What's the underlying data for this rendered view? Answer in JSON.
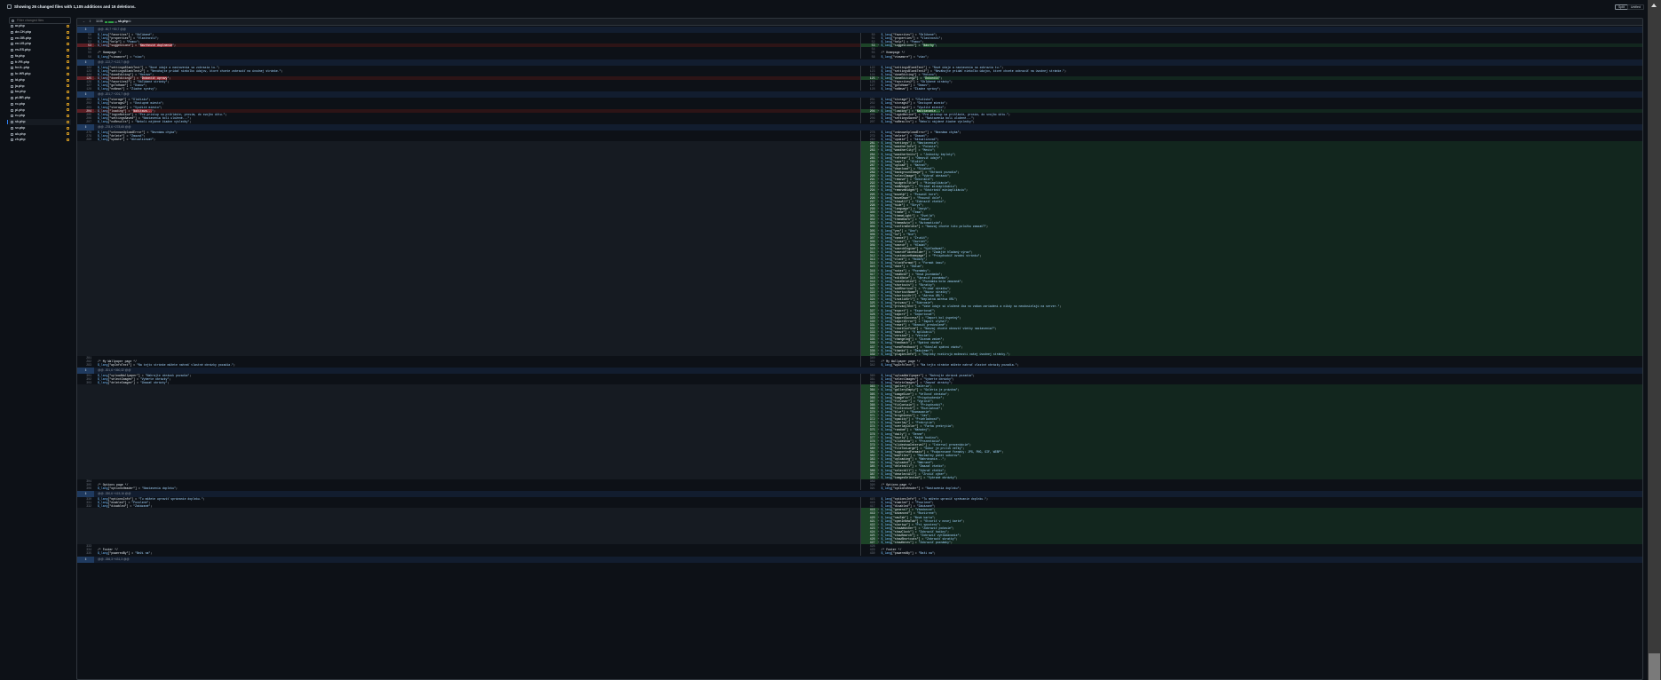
{
  "header": {
    "summary": "Showing 26 changed files with 1,105 additions and 16 deletions.",
    "split_label": "Split",
    "unified_label": "Unified"
  },
  "sidebar": {
    "filter_placeholder": "Filter changed files",
    "selected_index": 16,
    "files": [
      "ar.php",
      "de-CH.php",
      "en-GB.php",
      "en-US.php",
      "es-ES.php",
      "fa.php",
      "fr-FR.php",
      "he-IL.php",
      "hr-HR.php",
      "id.php",
      "ja.php",
      "ko.php",
      "pt-BR.php",
      "ro.php",
      "pl.php",
      "ru.php",
      "sk.php",
      "sv.php",
      "uk.php",
      "zh.php"
    ]
  },
  "file": {
    "changes": "1105",
    "name": "sk.php"
  },
  "hunks": [
    {
      "header": "@@ -50,7 +50,7 @@",
      "rows": [
        [
          "c",
          50,
          50,
          "$_lang[\"favorites\"] = \"Obľúbené\";"
        ],
        [
          "c",
          51,
          51,
          "$_lang[\"properties\"] = \"Vlastnosti\";"
        ],
        [
          "c",
          52,
          52,
          "$_lang[\"help\"] = \"Pomoc\";"
        ],
        [
          "m",
          53,
          53,
          "$_lang[\"suggestions\"] = \"Navrhnuté doplnenie\";",
          "$_lang[\"suggestions\"] = \"Návrhy\";",
          "Navrhnuté doplnenie",
          "Návrhy"
        ],
        [
          "c",
          54,
          54,
          ""
        ],
        [
          "c",
          55,
          55,
          "/* Homepage */"
        ],
        [
          "c",
          56,
          56,
          "$_lang[\"viewmore\"] = \"viac\";"
        ]
      ]
    },
    {
      "header": "@@ -122,7 +122,7 @@",
      "rows": [
        [
          "c",
          122,
          122,
          "$_lang[\"settingsBlankText\"] = \"Nové údaje a nastavenia sa zobrazia tu.\";"
        ],
        [
          "c",
          123,
          123,
          "$_lang[\"settingsBlankText2\"] = \"Neváhajte pridať niekoľko údajov, ktoré chcete zobraziť na úvodnej stránke.\";"
        ],
        [
          "c",
          124,
          124,
          "$_lang[\"doneEditing\"] = \"Hotovo\";"
        ],
        [
          "m",
          125,
          125,
          "$_lang[\"doneEditing2\"] = \"Dokončiť úpravy\";",
          "$_lang[\"doneEditing2\"] = \"Dokončiť\";",
          "Dokončiť úpravy",
          "Dokončiť"
        ],
        [
          "c",
          126,
          126,
          "$_lang[\"favorites2\"] = \"Obľúbené stránky\";"
        ],
        [
          "c",
          127,
          127,
          "$_lang[\"goToHome\"] = \"Domov\";"
        ],
        [
          "c",
          128,
          128,
          "$_lang[\"noNews\"] = \"Žiadne správy\";"
        ]
      ]
    },
    {
      "header": "@@ -201,7 +201,7 @@",
      "rows": [
        [
          "c",
          201,
          201,
          "$_lang[\"storage\"] = \"Úložisko\";"
        ],
        [
          "c",
          202,
          202,
          "$_lang[\"storage2\"] = \"Dostupné miesto\";"
        ],
        [
          "c",
          203,
          203,
          "$_lang[\"storage3\"] = \"Využité miesto\";"
        ],
        [
          "m",
          204,
          204,
          "$_lang[\"loading\"] = \"Načítava...\";",
          "$_lang[\"loading\"] = \"Načítavanie...\";",
          "Načítava...",
          "Načítavanie..."
        ],
        [
          "c",
          205,
          205,
          "$_lang[\"loginNotice\"] = \"Pre prístup sa prihláste, prosím, do svojho účtu.\";"
        ],
        [
          "c",
          206,
          206,
          "$_lang[\"settingsSaved\"] = \"Nastavenia boli uložené...\";"
        ],
        [
          "c",
          207,
          207,
          "$_lang[\"noResults\"] = \"Neboli nájdené žiadne výsledky\";"
        ]
      ]
    },
    {
      "header": "@@ -278,6 +278,65 @@",
      "rows": [
        [
          "c",
          278,
          278,
          "$_lang[\"unknownUploadError\"] = \"Neznáma chyba\";"
        ],
        [
          "c",
          279,
          279,
          "$_lang[\"delete\"] = \"Zmazať\";"
        ],
        [
          "c",
          280,
          280,
          "$_lang[\"update\"] = \"Aktualizovať\";"
        ],
        [
          "A",
          281,
          [
            "$_lang[\"settings\"] = \"Nastavenia\";",
            "$_lang[\"weatherInfo\"] = \"Počasie\";",
            "$_lang[\"weatherCity\"] = \"Mesto\";",
            "$_lang[\"weatherUnits\"] = \"Jednotky teploty\";",
            "$_lang[\"refresh\"] = \"Obnoviť údaje\";",
            "$_lang[\"save\"] = \"Uložiť\";",
            "$_lang[\"upload\"] = \"Nahrať\";",
            "$_lang[\"download\"] = \"Stiahnuť\";",
            "$_lang[\"backgroundImage\"] = \"Obrázok pozadia\";",
            "$_lang[\"selectImage\"] = \"Vybrať obrázok\";",
            "$_lang[\"remove\"] = \"Odstrániť\";",
            "$_lang[\"widgetsTitle\"] = \"Miniaplikácie\";",
            "$_lang[\"addWidget\"] = \"Pridať miniaplikáciu\";",
            "$_lang[\"removeWidget\"] = \"Odstrániť miniaplikáciu\";",
            "$_lang[\"moveUp\"] = \"Posunúť hore\";",
            "$_lang[\"moveDown\"] = \"Posunúť dole\";",
            "$_lang[\"showAll\"] = \"Zobraziť všetko\";",
            "$_lang[\"hide\"] = \"Skryť\";",
            "$_lang[\"language\"] = \"Jazyk\";",
            "$_lang[\"theme\"] = \"Téma\";",
            "$_lang[\"themeLight\"] = \"Svetlá\";",
            "$_lang[\"themeDark\"] = \"Tmavá\";",
            "$_lang[\"themeAuto\"] = \"Automatická\";",
            "$_lang[\"confirmDelete\"] = \"Naozaj chcete túto položku zmazať?\";",
            "$_lang[\"yes\"] = \"Áno\";",
            "$_lang[\"no\"] = \"Nie\";",
            "$_lang[\"cancel\"] = \"Zrušiť\";",
            "$_lang[\"close\"] = \"Zavrieť\";",
            "$_lang[\"search\"] = \"Hľadať\";",
            "$_lang[\"searchEngine\"] = \"Vyhľadávač\";",
            "$_lang[\"searchPlaceholder\"] = \"Zadajte hľadaný výraz\";",
            "$_lang[\"customizeHomepage\"] = \"Prispôsobiť úvodnú stránku\";",
            "$_lang[\"clock\"] = \"Hodiny\";",
            "$_lang[\"clockFormat\"] = \"Formát času\";",
            "$_lang[\"date\"] = \"Dátum\";",
            "$_lang[\"notes\"] = \"Poznámky\";",
            "$_lang[\"newNote\"] = \"Nová poznámka\";",
            "$_lang[\"editNote\"] = \"Upraviť poznámku\";",
            "$_lang[\"noteDeleted\"] = \"Poznámka bola zmazaná\";",
            "$_lang[\"shortcuts\"] = \"Skratky\";",
            "$_lang[\"addShortcut\"] = \"Pridať skratku\";",
            "$_lang[\"shortcutName\"] = \"Názov skratky\";",
            "$_lang[\"shortcutUrl\"] = \"Adresa URL\";",
            "$_lang[\"invalidUrl\"] = \"Neplatná adresa URL\";",
            "$_lang[\"privacy\"] = \"Súkromie\";",
            "$_lang[\"privacyText\"] = \"Vaše údaje sú uložené iba vo vašom zariadení a nikdy sa neodosielajú na server.\";",
            "$_lang[\"export\"] = \"Exportovať\";",
            "$_lang[\"import\"] = \"Importovať\";",
            "$_lang[\"importSuccess\"] = \"Import bol úspešný\";",
            "$_lang[\"importError\"] = \"Import zlyhal\";",
            "$_lang[\"reset\"] = \"Obnoviť predvolené\";",
            "$_lang[\"resetConfirm\"] = \"Naozaj chcete obnoviť všetky nastavenia?\";",
            "$_lang[\"about\"] = \"O aplikácii\";",
            "$_lang[\"version\"] = \"Verzia\";",
            "$_lang[\"changelog\"] = \"Zoznam zmien\";",
            "$_lang[\"feedback\"] = \"Spätná väzba\";",
            "$_lang[\"sendFeedback\"] = \"Odoslať spätnú väzbu\";",
            "$_lang[\"thanks\"] = \"Ďakujeme!\";",
            "$_lang[\"pluginsInfo\"] = \"Doplnky rozširujú možnosti vašej úvodnej stránky.\";"
          ]
        ],
        [
          "c",
          281,
          340,
          ""
        ],
        [
          "c",
          282,
          341,
          "/* My Wallpaper page */"
        ],
        [
          "c",
          283,
          342,
          "$_lang[\"wpInfoText\"] = \"Na tejto stránke môžete nahrať vlastné obrázky pozadia.\";"
        ]
      ]
    },
    {
      "header": "@@ -301,6 +360,32 @@",
      "rows": [
        [
          "c",
          301,
          360,
          "$_lang[\"uploadWallpaper\"] = \"Nahrajte obrázok pozadia\";"
        ],
        [
          "c",
          302,
          361,
          "$_lang[\"selectImages\"] = \"Vyberte obrázky\";"
        ],
        [
          "c",
          303,
          362,
          "$_lang[\"deleteImages\"] = \"Zmazať obrázky\";"
        ],
        [
          "A",
          363,
          [
            "$_lang[\"gallery\"] = \"Galéria\";",
            "$_lang[\"galleryEmpty\"] = \"Galéria je prázdna\";",
            "$_lang[\"imageSize\"] = \"Veľkosť obrázka\";",
            "$_lang[\"imageFit\"] = \"Prispôsobenie\";",
            "$_lang[\"fitCover\"] = \"Vyplniť\";",
            "$_lang[\"fitContain\"] = \"Prispôsobiť\";",
            "$_lang[\"fitStretch\"] = \"Roztiahnuť\";",
            "$_lang[\"blur\"] = \"Rozmazanie\";",
            "$_lang[\"brightness\"] = \"Jas\";",
            "$_lang[\"opacity\"] = \"Priehľadnosť\";",
            "$_lang[\"overlay\"] = \"Prekrytie\";",
            "$_lang[\"overlayColor\"] = \"Farba prekrytia\";",
            "$_lang[\"random\"] = \"Náhodný\";",
            "$_lang[\"daily\"] = \"Denne\";",
            "$_lang[\"hourly\"] = \"Každú hodinu\";",
            "$_lang[\"slideshow\"] = \"Prezentácia\";",
            "$_lang[\"slideshowInterval\"] = \"Interval prezentácie\";",
            "$_lang[\"fileTooLarge\"] = \"Súbor je príliš veľký\";",
            "$_lang[\"supportedFormats\"] = \"Podporované formáty: JPG, PNG, GIF, WEBP\";",
            "$_lang[\"maxFiles\"] = \"Maximálny počet súborov\";",
            "$_lang[\"uploading\"] = \"Nahrávanie...\";",
            "$_lang[\"uploaded\"] = \"Nahrané\";",
            "$_lang[\"deleteAll\"] = \"Zmazať všetko\";",
            "$_lang[\"selectAll\"] = \"Vybrať všetko\";",
            "$_lang[\"deselectAll\"] = \"Zrušiť výber\";",
            "$_lang[\"imagesSelected\"] = \"Vybrané obrázky\";"
          ]
        ],
        [
          "c",
          304,
          389,
          ""
        ],
        [
          "c",
          305,
          390,
          "/* Options page */"
        ],
        [
          "c",
          306,
          391,
          "$_lang[\"optionsHeader\"] = \"Nastavenia doplnku\";"
        ]
      ]
    },
    {
      "header": "@@ -330,6 +415,16 @@",
      "rows": [
        [
          "c",
          330,
          415,
          "$_lang[\"optionsInfo\"] = \"Tu môžete upraviť správanie doplnku.\";"
        ],
        [
          "c",
          331,
          416,
          "$_lang[\"enabled\"] = \"Povolené\";"
        ],
        [
          "c",
          332,
          417,
          "$_lang[\"disabled\"] = \"Zakázané\";"
        ],
        [
          "A",
          418,
          [
            "$_lang[\"general\"] = \"Všeobecné\";",
            "$_lang[\"advanced\"] = \"Rozšírené\";",
            "$_lang[\"newTab\"] = \"Nová karta\";",
            "$_lang[\"openInNewTab\"] = \"Otvoriť v novej karte\";",
            "$_lang[\"startup\"] = \"Pri spustení\";",
            "$_lang[\"showWeather\"] = \"Zobraziť počasie\";",
            "$_lang[\"showClock\"] = \"Zobraziť hodiny\";",
            "$_lang[\"showSearch\"] = \"Zobraziť vyhľadávanie\";",
            "$_lang[\"showShortcuts\"] = \"Zobraziť skratky\";",
            "$_lang[\"showNotes\"] = \"Zobraziť poznámky\";"
          ]
        ],
        [
          "c",
          333,
          428,
          ""
        ],
        [
          "c",
          334,
          429,
          "/* Footer */"
        ],
        [
          "c",
          335,
          430,
          "$_lang[\"poweredBy\"] = \"Beží na\";"
        ]
      ]
    },
    {
      "header": "@@ -336,3 +431,3 @@",
      "rows": []
    }
  ]
}
